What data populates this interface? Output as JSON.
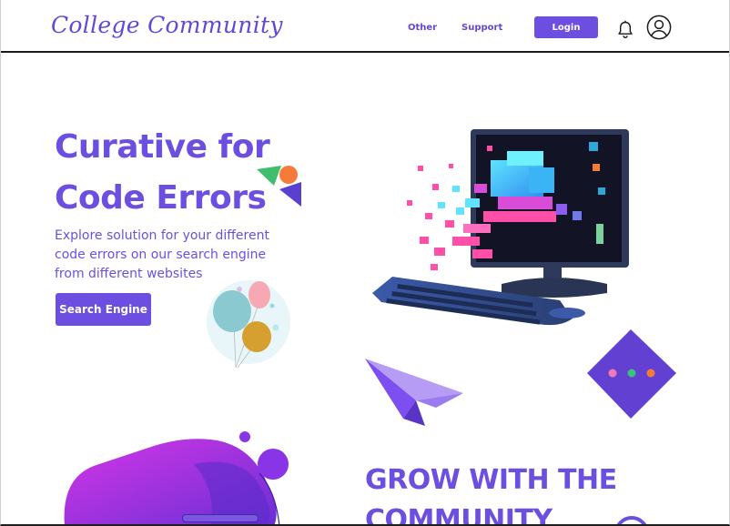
{
  "header": {
    "logo": "College Community",
    "nav": {
      "other": "Other",
      "support": "Support"
    },
    "login_label": "Login",
    "icons": {
      "bell": "bell-icon",
      "profile": "user-circle-icon"
    }
  },
  "hero": {
    "title_line1": "Curative for",
    "title_line2": "Code Errors",
    "description": "Explore solution for your different code errors on our search engine from different websites",
    "search_button": "Search Engine"
  },
  "community": {
    "title_line1": "GROW WITH THE",
    "title_line2": "COMMUNITY"
  },
  "colors": {
    "accent": "#6c4fe0",
    "header_border": "#1a1a1a",
    "diamond": "#6140d2",
    "dot_pink": "#f07ab8",
    "dot_green": "#3cc07a",
    "dot_orange": "#f57b39"
  }
}
